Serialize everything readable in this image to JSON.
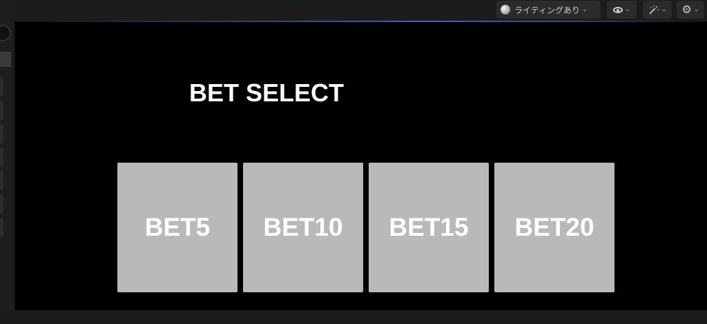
{
  "toolbar": {
    "lighting_label": "ライティングあり",
    "lighting_icon": "lit-sphere-icon",
    "view_icon": "eye-icon",
    "fx_icon": "magic-wand-icon",
    "settings_icon": "gear-icon",
    "accent_color": "#2a6ad0"
  },
  "game": {
    "title": "BET SELECT",
    "bets": [
      {
        "label": "BET5"
      },
      {
        "label": "BET10"
      },
      {
        "label": "BET15"
      },
      {
        "label": "BET20"
      }
    ],
    "button_color": "#b9b9b9",
    "background_color": "#000000"
  }
}
